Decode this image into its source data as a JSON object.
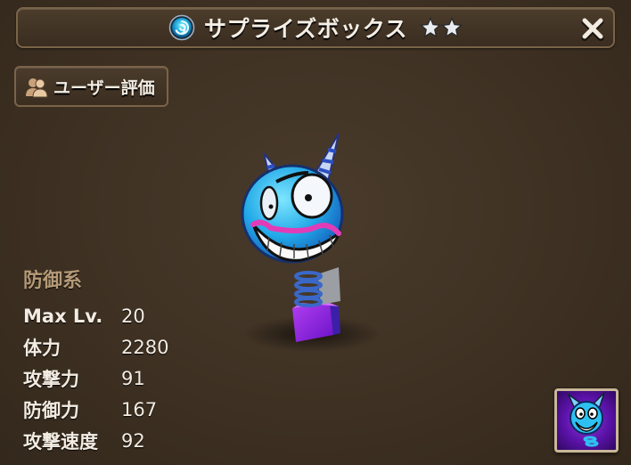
{
  "header": {
    "title": "サプライズボックス",
    "stars": 2,
    "element": "water"
  },
  "review_button": {
    "label": "ユーザー評価"
  },
  "monster": {
    "type_label": "防御系",
    "stats": [
      {
        "name": "Max Lv.",
        "value": "20"
      },
      {
        "name": "体力",
        "value": "2280"
      },
      {
        "name": "攻撃力",
        "value": "91"
      },
      {
        "name": "防御力",
        "value": "167"
      },
      {
        "name": "攻撃速度",
        "value": "92"
      }
    ]
  },
  "colors": {
    "background": "#3f3223",
    "frame": "#7a6448",
    "type_label": "#b59a77",
    "skill_bg": "#5b12a8"
  },
  "icons": {
    "element": "water-element-icon",
    "star": "star-icon",
    "close": "close-icon",
    "users": "users-icon",
    "skill": "skill-icon"
  }
}
